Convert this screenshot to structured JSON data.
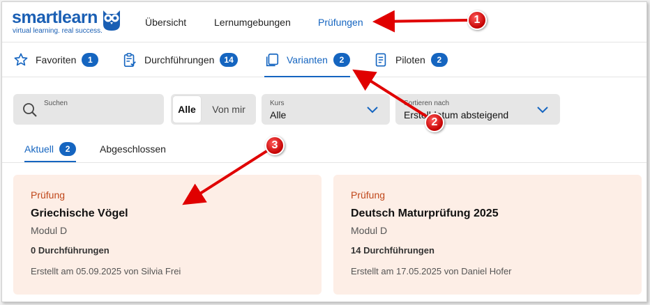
{
  "logo": {
    "name": "smartlearn",
    "tagline": "virtual learning. real success."
  },
  "nav": {
    "overview": "Übersicht",
    "environments": "Lernumgebungen",
    "exams": "Prüfungen"
  },
  "subtabs": [
    {
      "label": "Favoriten",
      "count": "1",
      "icon": "star-icon"
    },
    {
      "label": "Durchführungen",
      "count": "14",
      "icon": "clipboard-icon"
    },
    {
      "label": "Varianten",
      "count": "2",
      "icon": "copy-icon"
    },
    {
      "label": "Piloten",
      "count": "2",
      "icon": "document-icon"
    }
  ],
  "filters": {
    "search_label": "Suchen",
    "toggle_all": "Alle",
    "toggle_mine": "Von mir",
    "course_label": "Kurs",
    "course_value": "Alle",
    "sort_label": "Sortieren nach",
    "sort_value": "Erstelldatum absteigend"
  },
  "status_tabs": {
    "current": "Aktuell",
    "current_count": "2",
    "closed": "Abgeschlossen"
  },
  "cards": [
    {
      "type": "Prüfung",
      "title": "Griechische Vögel",
      "module": "Modul D",
      "runs": "0 Durchführungen",
      "created": "Erstellt am 05.09.2025 von Silvia Frei"
    },
    {
      "type": "Prüfung",
      "title": "Deutsch Maturprüfung 2025",
      "module": "Modul D",
      "runs": "14 Durchführungen",
      "created": "Erstellt am 17.05.2025 von Daniel Hofer"
    }
  ],
  "annotations": [
    "1",
    "2",
    "3"
  ],
  "colors": {
    "accent": "#1565c0",
    "card_bg": "#fdeee6",
    "card_type": "#c0471a",
    "annotation": "#e00000"
  }
}
